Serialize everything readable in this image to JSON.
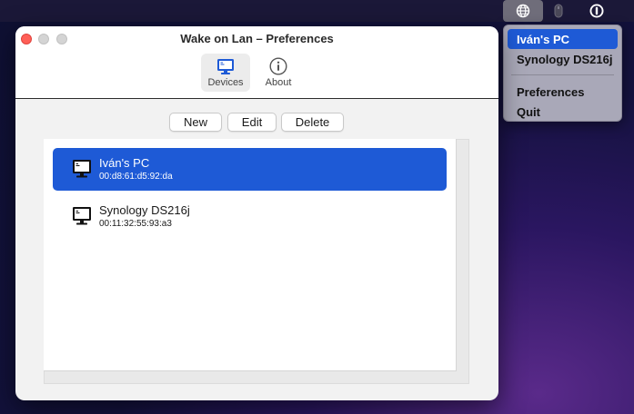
{
  "menubar": {
    "icons": [
      "globe-icon",
      "mouse-icon",
      "power-icon"
    ]
  },
  "menu": {
    "items": [
      "Iván's PC",
      "Synology DS216j"
    ],
    "actions": [
      "Preferences",
      "Quit"
    ]
  },
  "window": {
    "title": "Wake on Lan – Preferences",
    "tabs": [
      {
        "label": "Devices",
        "icon": "monitor-icon"
      },
      {
        "label": "About",
        "icon": "info-icon"
      }
    ],
    "buttons": {
      "new": "New",
      "edit": "Edit",
      "delete": "Delete"
    },
    "devices": [
      {
        "name": "Iván's PC",
        "mac": "00:d8:61:d5:92:da",
        "selected": true
      },
      {
        "name": "Synology DS216j",
        "mac": "00:11:32:55:93:a3",
        "selected": false
      }
    ]
  },
  "colors": {
    "accent": "#1e5ad6",
    "close": "#ff5f57"
  }
}
